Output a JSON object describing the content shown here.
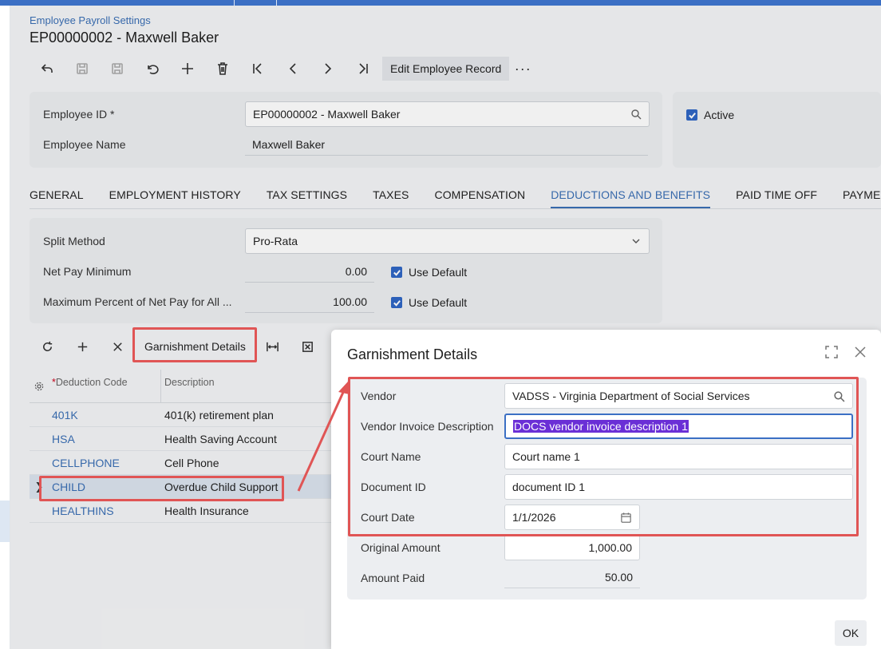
{
  "page": {
    "breadcrumb": "Employee Payroll Settings",
    "title": "EP00000002 - Maxwell Baker"
  },
  "toolbar": {
    "edit_label": "Edit Employee Record",
    "more_label": "···"
  },
  "summary": {
    "employee_id_label": "Employee ID",
    "employee_id_value": "EP00000002 - Maxwell Baker",
    "employee_name_label": "Employee Name",
    "employee_name_value": "Maxwell Baker",
    "active_label": "Active",
    "active_checked": true
  },
  "tabs": [
    {
      "label": "GENERAL"
    },
    {
      "label": "EMPLOYMENT HISTORY"
    },
    {
      "label": "TAX SETTINGS"
    },
    {
      "label": "TAXES"
    },
    {
      "label": "COMPENSATION"
    },
    {
      "label": "DEDUCTIONS AND BENEFITS",
      "active": true
    },
    {
      "label": "PAID TIME OFF"
    },
    {
      "label": "PAYMEN"
    }
  ],
  "deductions": {
    "split_method_label": "Split Method",
    "split_method_value": "Pro-Rata",
    "net_pay_min_label": "Net Pay Minimum",
    "net_pay_min_value": "0.00",
    "max_percent_label": "Maximum Percent of Net Pay for All ...",
    "max_percent_value": "100.00",
    "use_default_label": "Use Default"
  },
  "grid": {
    "garnishment_button": "Garnishment Details",
    "headers": {
      "deduction_code": "Deduction Code",
      "description": "Description"
    },
    "rows": [
      {
        "code": "401K",
        "description": "401(k) retirement plan"
      },
      {
        "code": "HSA",
        "description": "Health Saving Account"
      },
      {
        "code": "CELLPHONE",
        "description": "Cell Phone"
      },
      {
        "code": "CHILD",
        "description": "Overdue Child Support",
        "selected": true
      },
      {
        "code": "HEALTHINS",
        "description": "Health Insurance"
      }
    ]
  },
  "dialog": {
    "title": "Garnishment Details",
    "vendor_label": "Vendor",
    "vendor_value": "VADSS - Virginia Department of Social Services",
    "invoice_desc_label": "Vendor Invoice Description",
    "invoice_desc_value": "DOCS vendor invoice description 1",
    "court_name_label": "Court Name",
    "court_name_value": "Court name 1",
    "document_id_label": "Document ID",
    "document_id_value": "document ID 1",
    "court_date_label": "Court Date",
    "court_date_value": "1/1/2026",
    "original_amount_label": "Original Amount",
    "original_amount_value": "1,000.00",
    "amount_paid_label": "Amount Paid",
    "amount_paid_value": "50.00",
    "ok_label": "OK"
  },
  "colors": {
    "accent": "#3a6fb5",
    "annotation_red": "#e05555",
    "selection": "#6a2fd6"
  }
}
